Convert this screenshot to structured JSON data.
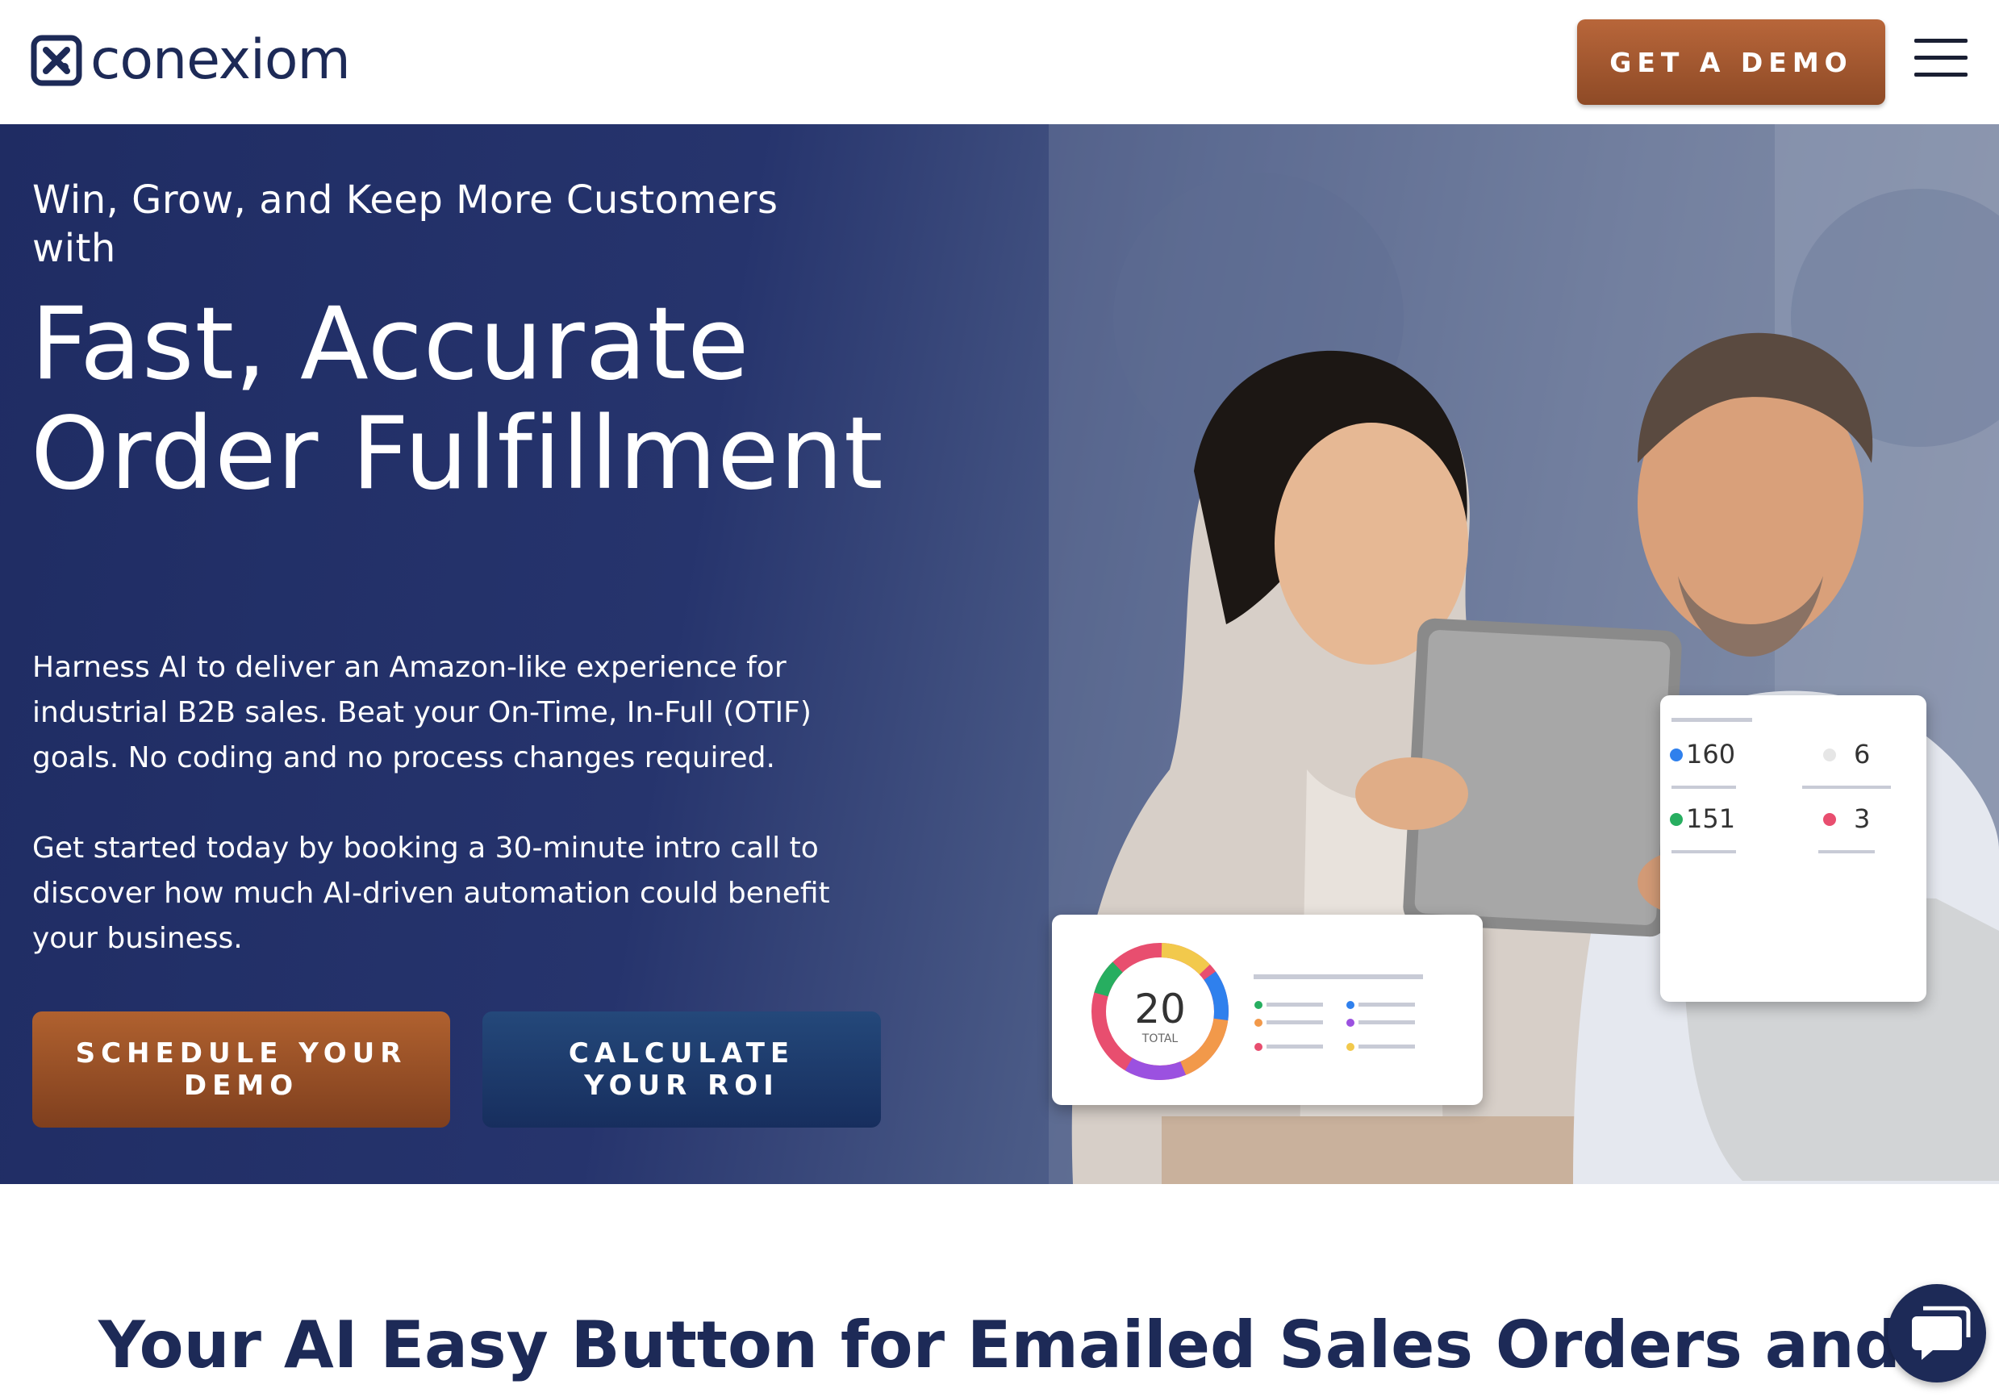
{
  "header": {
    "logo_text": "conexiom",
    "cta_label": "GET A DEMO",
    "menu_icon": "hamburger-menu-icon"
  },
  "hero": {
    "kicker": "Win, Grow, and Keep More Customers with",
    "title": "Fast, Accurate Order Fulfillment",
    "paragraph_1": "Harness AI to deliver an Amazon-like experience for industrial B2B sales. Beat your On-Time, In-Full (OTIF) goals. No coding and no process changes required.",
    "paragraph_2": "Get started today by booking a 30-minute intro call to discover how much AI-driven automation could benefit your business.",
    "primary_button": "SCHEDULE YOUR DEMO",
    "secondary_button": "CALCULATE YOUR ROI"
  },
  "dashboard": {
    "donut_total": "20",
    "donut_label": "TOTAL",
    "stats": [
      "160",
      "6",
      "151",
      "3"
    ]
  },
  "section": {
    "heading": "Your AI Easy Button for Emailed Sales Orders and"
  },
  "chat": {
    "icon": "chat-bubble-icon"
  },
  "colors": {
    "navy": "#1d2a57",
    "copper": "#a65a30",
    "button_blue": "#1e3d6e"
  }
}
